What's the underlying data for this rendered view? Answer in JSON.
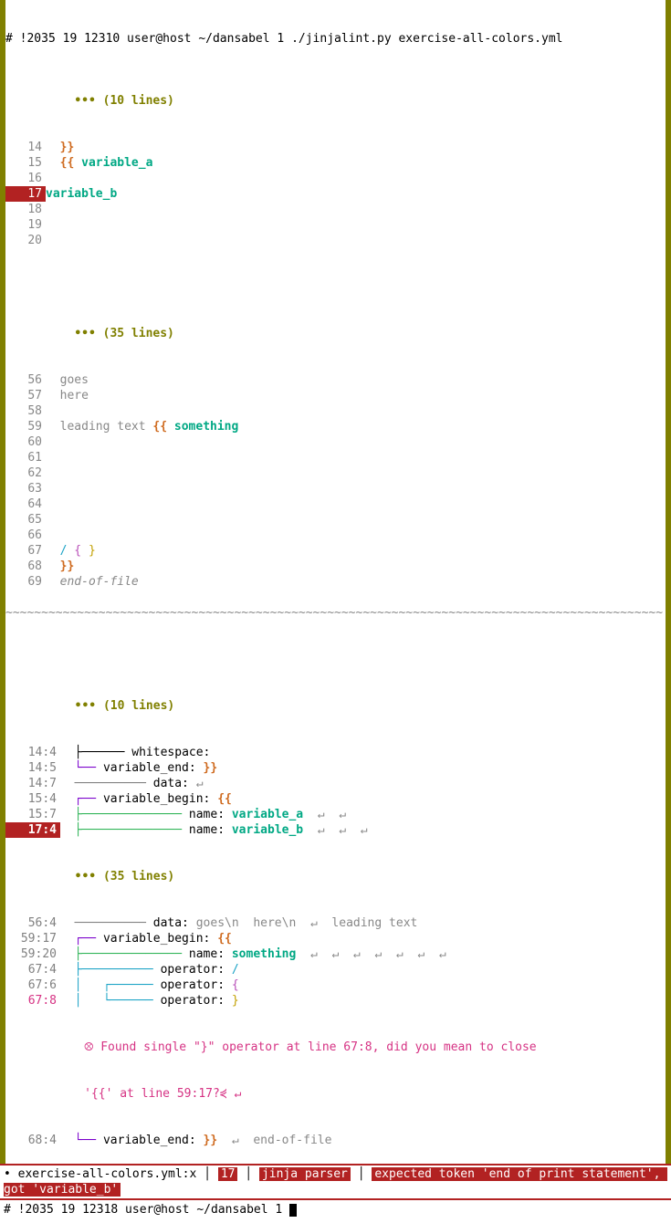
{
  "top_prompt": "# !2035 19 12310 user@host ~/dansabel 1 ./jinjalint.py exercise-all-colors.yml",
  "upper": {
    "fold1": "••• (10 lines)",
    "lines": [
      {
        "num": "14",
        "pre": "  ",
        "a": "}}"
      },
      {
        "num": "15",
        "pre": "  ",
        "a": "{{ ",
        "var": "variable_a"
      },
      {
        "num": "16",
        "pre": ""
      },
      {
        "num": "17",
        "hl": true,
        "var": "variable_b",
        "nopad": true
      },
      {
        "num": "18",
        "pre": ""
      },
      {
        "num": "19",
        "pre": ""
      },
      {
        "num": "20",
        "pre": ""
      }
    ],
    "fold2": "••• (35 lines)",
    "lines2": [
      {
        "num": "56",
        "txt": "  goes"
      },
      {
        "num": "57",
        "txt": "  here"
      },
      {
        "num": "58",
        "txt": ""
      },
      {
        "num": "59",
        "lead": "  leading text ",
        "a": "{{ ",
        "var": "something"
      },
      {
        "num": "60",
        "txt": ""
      },
      {
        "num": "61",
        "txt": ""
      },
      {
        "num": "62",
        "txt": ""
      },
      {
        "num": "63",
        "txt": ""
      },
      {
        "num": "64",
        "txt": ""
      },
      {
        "num": "65",
        "txt": ""
      },
      {
        "num": "66",
        "txt": ""
      },
      {
        "num": "67",
        "sp": "  ",
        "s1": "/",
        "s2": " { ",
        "s3": "}"
      },
      {
        "num": "68",
        "sp": "  ",
        "a": "}}"
      },
      {
        "num": "69",
        "txt": "  end-of-file",
        "dim": true
      }
    ]
  },
  "lower": {
    "fold1": "••• (10 lines)",
    "rows": [
      {
        "pos": "14:4",
        "tree": "├──────",
        "tcls": "branch-black",
        "label": " whitespace:",
        "val": ""
      },
      {
        "pos": "14:5",
        "tree": "└──",
        "tcls": "branch-purple",
        "label": " variable_end: ",
        "orange": "}}"
      },
      {
        "pos": "14:7",
        "tree": "──────────",
        "tcls": "branch-gray",
        "label": " data: ",
        "tail_nl": "↵"
      },
      {
        "pos": "15:4",
        "tree": "┌──",
        "tcls": "branch-purple",
        "label": " variable_begin: ",
        "orange": "{{"
      },
      {
        "pos": "15:7",
        "tree": "├──────────────",
        "tcls": "branch-green",
        "label": " name: ",
        "var": "variable_a",
        "arrows": "  ↵  ↵"
      },
      {
        "pos": "17:4",
        "hl": true,
        "tree": "├──────────────",
        "tcls": "branch-green",
        "label": " name: ",
        "var": "variable_b",
        "arrows": "  ↵  ↵  ↵"
      }
    ],
    "fold2": "••• (35 lines)",
    "rows2": [
      {
        "pos": "56:4",
        "tree": "──────────",
        "tcls": "branch-gray",
        "label": " data: ",
        "dimtxt": "goes\\n  here\\n  ↵  leading text"
      },
      {
        "pos": "59:17",
        "tree": "┌──",
        "tcls": "branch-purple",
        "label": " variable_begin: ",
        "orange": "{{"
      },
      {
        "pos": "59:20",
        "tree": "├──────────────",
        "tcls": "branch-green",
        "label": " name: ",
        "var": "something",
        "arrows": "  ↵  ↵  ↵  ↵  ↵  ↵  ↵"
      },
      {
        "pos": "67:4",
        "tree": "├──────────",
        "tcls": "branch-teal",
        "label": " operator: ",
        "op": "/",
        "opcls": "slash"
      },
      {
        "pos": "67:6",
        "tree": "│   ┌──────",
        "tcls": "branch-teal",
        "label": " operator: ",
        "op": "{",
        "opcls": "brace1"
      },
      {
        "pos": "67:8",
        "pink": true,
        "tree": "│   └──────",
        "tcls": "branch-teal",
        "label": " operator: ",
        "op": "}",
        "opcls": "brace2"
      }
    ],
    "error1": "           ⮾ Found single \"}\" operator at line 67:8, did you mean to close",
    "error2": "           '{{' at line 59:17?⋞ ↵",
    "last": {
      "pos": "68:4",
      "tree": "└──",
      "tcls": "branch-purple",
      "label": " variable_end: ",
      "orange": "}}",
      "tail": "  ↵  end-of-file"
    }
  },
  "status": {
    "bullet": "•",
    "file": "exercise-all-colors.yml:x",
    "line": "17",
    "parser": "jinja parser",
    "err": "expected token 'end of print statement', got 'variable_b'"
  },
  "bottom_prompt": "# !2035 19 12318 user@host ~/dansabel 1 "
}
